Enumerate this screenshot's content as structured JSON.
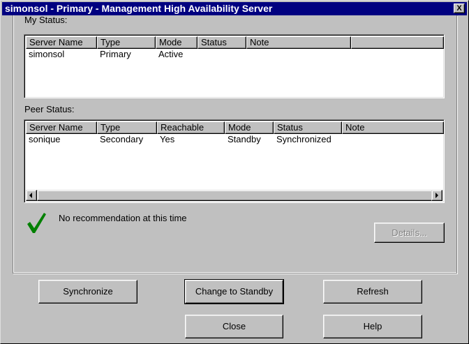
{
  "window": {
    "title": "simonsol - Primary - Management High Availability Server",
    "close_glyph": "X"
  },
  "my_status": {
    "label": "My Status:",
    "columns": [
      "Server Name",
      "Type",
      "Mode",
      "Status",
      "Note"
    ],
    "rows": [
      [
        "simonsol",
        "Primary",
        "Active",
        "",
        ""
      ]
    ]
  },
  "peer_status": {
    "label": "Peer Status:",
    "columns": [
      "Server Name",
      "Type",
      "Reachable",
      "Mode",
      "Status",
      "Note"
    ],
    "rows": [
      [
        "sonique",
        "Secondary",
        "Yes",
        "Standby",
        "Synchronized",
        ""
      ]
    ]
  },
  "recommendation": {
    "icon": "green-checkmark-icon",
    "icon_color": "#008000",
    "text": "No recommendation at this time"
  },
  "buttons": {
    "details": "Details...",
    "synchronize": "Synchronize",
    "change_to_standby": "Change to Standby",
    "refresh": "Refresh",
    "close": "Close",
    "help": "Help"
  },
  "colors": {
    "titlebar": "#000080",
    "face": "#c0c0c0"
  }
}
